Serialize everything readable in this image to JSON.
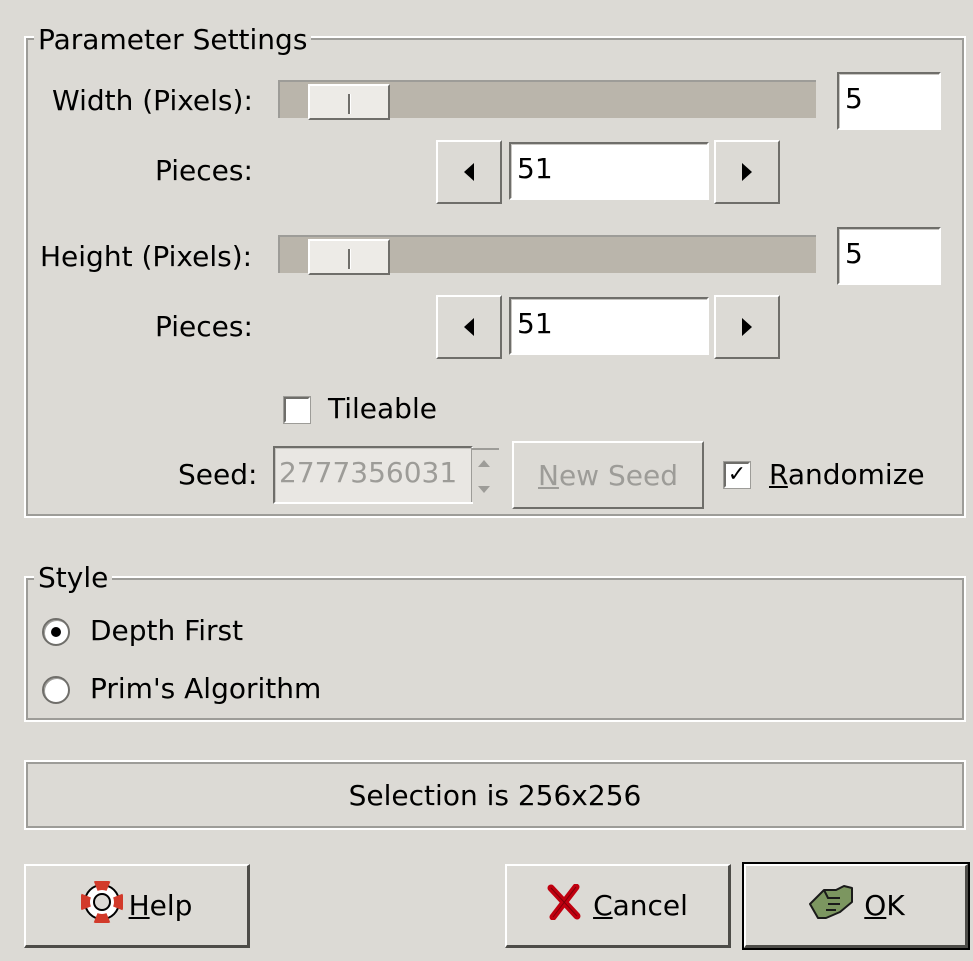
{
  "params": {
    "legend": "Parameter Settings",
    "width_label": "Width (Pixels):",
    "width_value": "5",
    "width_slider_fraction": 0.04,
    "width_pieces_label": "Pieces:",
    "width_pieces_value": "51",
    "height_label": "Height (Pixels):",
    "height_value": "5",
    "height_slider_fraction": 0.04,
    "height_pieces_label": "Pieces:",
    "height_pieces_value": "51",
    "tileable_label": "Tileable",
    "tileable_checked": false,
    "seed_label": "Seed:",
    "seed_value": "2777356031",
    "new_seed_label": "New Seed",
    "randomize_label": "Randomize",
    "randomize_checked": true
  },
  "style": {
    "legend": "Style",
    "options": [
      {
        "label": "Depth First",
        "selected": true
      },
      {
        "label": "Prim's Algorithm",
        "selected": false
      }
    ]
  },
  "status": {
    "text": "Selection is 256x256"
  },
  "buttons": {
    "help": "Help",
    "cancel": "Cancel",
    "ok": "OK"
  },
  "icons": {
    "help": "lifebuoy-icon",
    "cancel": "red-x-icon",
    "ok": "hand-pointer-icon",
    "decrement": "triangle-left-icon",
    "increment": "triangle-right-icon"
  },
  "colors": {
    "background": "#dcdad5",
    "trough": "#bab5ab",
    "cancel_icon": "#c0000f",
    "ok_icon": "#7c9660"
  }
}
